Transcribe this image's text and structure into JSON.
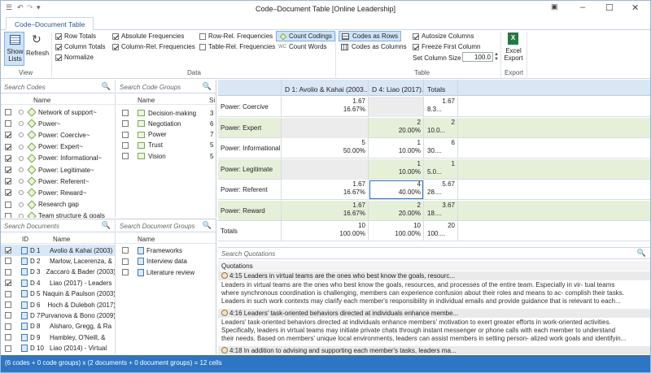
{
  "window": {
    "title": "Code–Document Table [Online Leadership]"
  },
  "tab": "Code–Document Table",
  "ribbon": {
    "show_lists": "Show Lists",
    "refresh": "Refresh",
    "row_totals": "Row Totals",
    "column_totals": "Column Totals",
    "normalize": "Normalize",
    "absolute_frequencies": "Absolute Frequencies",
    "column_rel_frequencies": "Column-Rel. Frequencies",
    "row_rel_frequencies": "Row-Rel. Frequencies",
    "table_rel_frequencies": "Table-Rel. Frequencies",
    "count_codings": "Count Codings",
    "count_words": "Count Words",
    "codes_as_rows": "Codes as Rows",
    "codes_as_columns": "Codes as Columns",
    "autosize_columns": "Autosize Columns",
    "freeze_first_column": "Freeze First Column",
    "set_column_size": "Set Column Size",
    "column_size_value": "100.0",
    "excel_export": "Excel Export",
    "groups": {
      "view": "View",
      "data": "Data",
      "table": "Table",
      "export": "Export"
    }
  },
  "codes_panel": {
    "search_placeholder": "Search Codes",
    "col_name": "Name",
    "items": [
      {
        "name": "Network of support~",
        "checked": false
      },
      {
        "name": "Power~",
        "checked": false
      },
      {
        "name": "Power: Coercive~",
        "checked": true
      },
      {
        "name": "Power: Expert~",
        "checked": true
      },
      {
        "name": "Power: Informational~",
        "checked": true
      },
      {
        "name": "Power: Legitimate~",
        "checked": true
      },
      {
        "name": "Power: Referent~",
        "checked": true
      },
      {
        "name": "Power: Reward~",
        "checked": true
      },
      {
        "name": "Research gap",
        "checked": false
      },
      {
        "name": "Team structure & goals",
        "checked": false
      }
    ]
  },
  "code_groups_panel": {
    "search_placeholder": "Search Code Groups",
    "col_name": "Name",
    "col_s": "Si",
    "items": [
      {
        "name": "Decision-making",
        "size": "3"
      },
      {
        "name": "Negotiation",
        "size": "6"
      },
      {
        "name": "Power",
        "size": "7"
      },
      {
        "name": "Trust",
        "size": "5"
      },
      {
        "name": "Vision",
        "size": "5"
      }
    ]
  },
  "documents_panel": {
    "search_placeholder": "Search Documents",
    "col_id": "ID",
    "col_name": "Name",
    "items": [
      {
        "id": "D 1",
        "name": "Avolio & Kahai (2003)",
        "checked": true,
        "selected": true
      },
      {
        "id": "D 2",
        "name": "Marlow, Lacerenza, &",
        "checked": false
      },
      {
        "id": "D 3",
        "name": "Zaccaro & Bader (2003)",
        "checked": false
      },
      {
        "id": "D 4",
        "name": "Liao (2017) - Leaders",
        "checked": true
      },
      {
        "id": "D 5",
        "name": "Naquin & Paulson (2003)",
        "checked": false
      },
      {
        "id": "D 6",
        "name": "Hoch & Duleboh (2017)",
        "checked": false
      },
      {
        "id": "D 7",
        "name": "Purvanova & Bono (2009)",
        "checked": false
      },
      {
        "id": "D 8",
        "name": "Alsharo, Gregg, & Ra",
        "checked": false
      },
      {
        "id": "D 9",
        "name": "Hambley, O'Neill, &",
        "checked": false
      },
      {
        "id": "D 10",
        "name": "Liao (2014) - Virtual",
        "checked": false
      }
    ]
  },
  "doc_groups_panel": {
    "search_placeholder": "Search Document Groups",
    "col_name": "Name",
    "items": [
      "Frameworks",
      "Interview data",
      "Literature review"
    ]
  },
  "table": {
    "headers": [
      "",
      "D 1: Avolio & Kahai (2003...",
      "D 4: Liao (2017)...",
      "Totals"
    ],
    "rows": [
      {
        "label": "Power: Coercive",
        "d1": [
          "1.67",
          "16.67%"
        ],
        "d4": null,
        "tot": [
          "1.67",
          "8.3..."
        ]
      },
      {
        "label": "Power: Expert",
        "d1": null,
        "d4": [
          "2",
          "20.00%"
        ],
        "tot": [
          "2",
          "10.0..."
        ]
      },
      {
        "label": "Power: Informational",
        "d1": [
          "5",
          "50.00%"
        ],
        "d4": [
          "1",
          "10.00%"
        ],
        "tot": [
          "6",
          "30...."
        ]
      },
      {
        "label": "Power: Legitimate",
        "d1": null,
        "d4": [
          "1",
          "10.00%"
        ],
        "tot": [
          "1",
          "5.0..."
        ]
      },
      {
        "label": "Power: Referent",
        "d1": [
          "1.67",
          "16.67%"
        ],
        "d4": [
          "4",
          "40.00%"
        ],
        "tot": [
          "5.67",
          "28...."
        ]
      },
      {
        "label": "Power: Reward",
        "d1": [
          "1.67",
          "16.67%"
        ],
        "d4": [
          "2",
          "20.00%"
        ],
        "tot": [
          "3.67",
          "18...."
        ]
      },
      {
        "label": "Totals",
        "d1": [
          "10",
          "100.00%"
        ],
        "d4": [
          "10",
          "100.00%"
        ],
        "tot": [
          "20",
          "100...."
        ]
      }
    ]
  },
  "quotations": {
    "search_placeholder": "Search Quotations",
    "header": "Quotations",
    "items": [
      {
        "title": "4:15 Leaders in virtual teams are the ones who best know the goals, resourc...",
        "lines": [
          "Leaders in virtual teams are the ones who best know the goals, resources, and processes of the entire team. Especially in vir- tual teams",
          "where synchronous coordination is challenging, members can experience confusion about their roles and means to ac- complish their tasks.",
          "Leaders in such work contexts may clarify each member's responsibility in individual emails and provide guidance that is relevant to each..."
        ]
      },
      {
        "title": "4:16 Leaders' task-oriented behaviors directed at individuals enhance membe...",
        "lines": [
          "Leaders' task-oriented behaviors directed at individuals enhance members' motivation to exert greater efforts in work-oriented activities.",
          "Specifically, leaders in virtual teams may initiate private chats through instant messenger or phone calls with each member to understand",
          "their needs. Based on members' unique local environments, leaders can assist members in setting person- alized work goals and identifyin..."
        ]
      },
      {
        "title": "4:18 In addition to advising and supporting each member's tasks, leaders ma...",
        "lines": []
      }
    ]
  },
  "status": "(6 codes + 0 code groups) x (2 documents + 0 document groups) = 12 cells"
}
